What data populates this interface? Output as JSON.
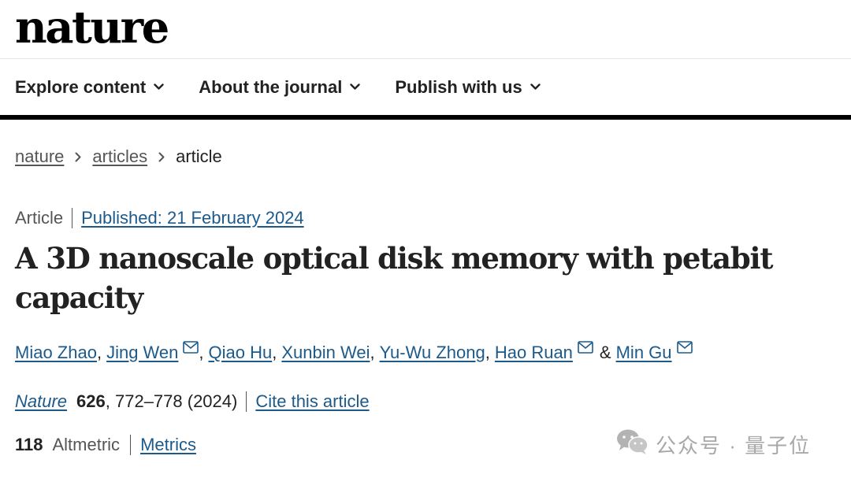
{
  "header": {
    "logo": "nature"
  },
  "nav": {
    "items": [
      {
        "label": "Explore content"
      },
      {
        "label": "About the journal"
      },
      {
        "label": "Publish with us"
      }
    ]
  },
  "breadcrumb": {
    "items": [
      "nature",
      "articles"
    ],
    "current": "article"
  },
  "article": {
    "type": "Article",
    "published": "Published: 21 February 2024",
    "title": "A 3D nanoscale optical disk memory with petabit capacity",
    "authors": [
      {
        "name": "Miao Zhao",
        "sep": ","
      },
      {
        "name": "Jing Wen",
        "sep": ","
      },
      {
        "name": "Qiao Hu",
        "sep": ","
      },
      {
        "name": "Xunbin Wei",
        "sep": ","
      },
      {
        "name": "Yu-Wu Zhong",
        "sep": ","
      },
      {
        "name": "Hao Ruan",
        "sep": "&"
      },
      {
        "name": "Min Gu",
        "sep": ""
      }
    ],
    "citation": {
      "journal": "Nature",
      "volume": "626",
      "pages": ", 772–778 (2024)",
      "cite_label": "Cite this article"
    },
    "metrics": {
      "altmetric_count": "118",
      "altmetric_label": "Altmetric",
      "metrics_label": "Metrics"
    }
  },
  "watermark": {
    "text": "公众号 · 量子位",
    "icon": "wechat-icon"
  },
  "colors": {
    "link": "#1c5a8c",
    "text": "#222222",
    "muted": "#555555"
  }
}
